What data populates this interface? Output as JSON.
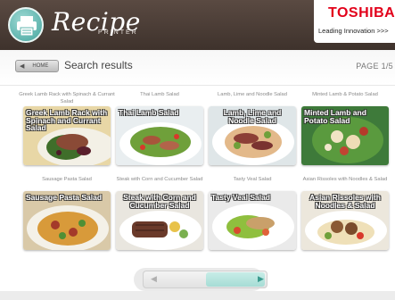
{
  "app": {
    "logo_text": "Recipe",
    "logo_sub": "PRINTER",
    "brand_name": "TOSHIBA",
    "brand_tagline": "Leading Innovation >>>"
  },
  "toolbar": {
    "home_label": "HOME",
    "title": "Search results",
    "page_indicator": "PAGE 1/5"
  },
  "recipes": [
    {
      "caption": "Greek Lamb Rack with Spinach & Currant Salad",
      "overlay": "Greek Lamb Rack with Spinach and Currant Salad"
    },
    {
      "caption": "Thai Lamb Salad",
      "overlay": "Thai Lamb Salad"
    },
    {
      "caption": "Lamb, Lime and Noodle Salad",
      "overlay": "Lamb, Lime and Noodle Salad"
    },
    {
      "caption": "Minted Lamb & Potato Salad",
      "overlay": "Minted Lamb and Potato Salad"
    },
    {
      "caption": "Sausage Pasta Salad",
      "overlay": "Sausage Pasta Salad"
    },
    {
      "caption": "Steak with Corn and Cucumber Salad",
      "overlay": "Steak with Corn and Cucumber Salad"
    },
    {
      "caption": "Tasty Veal Salad",
      "overlay": "Tasty Veal Salad"
    },
    {
      "caption": "Asian Rissoles with Noodles & Salad",
      "overlay": "Asian Rissoles with Noodles & Salad"
    }
  ],
  "icons": {
    "logo": "printer-icon",
    "home": "left-arrow-icon",
    "pager_prev": "left-triangle-icon",
    "pager_next": "right-triangle-icon"
  },
  "colors": {
    "header_bg": "#4a3c35",
    "brand_red": "#e2001a",
    "accent_teal": "#6cc4bb"
  }
}
